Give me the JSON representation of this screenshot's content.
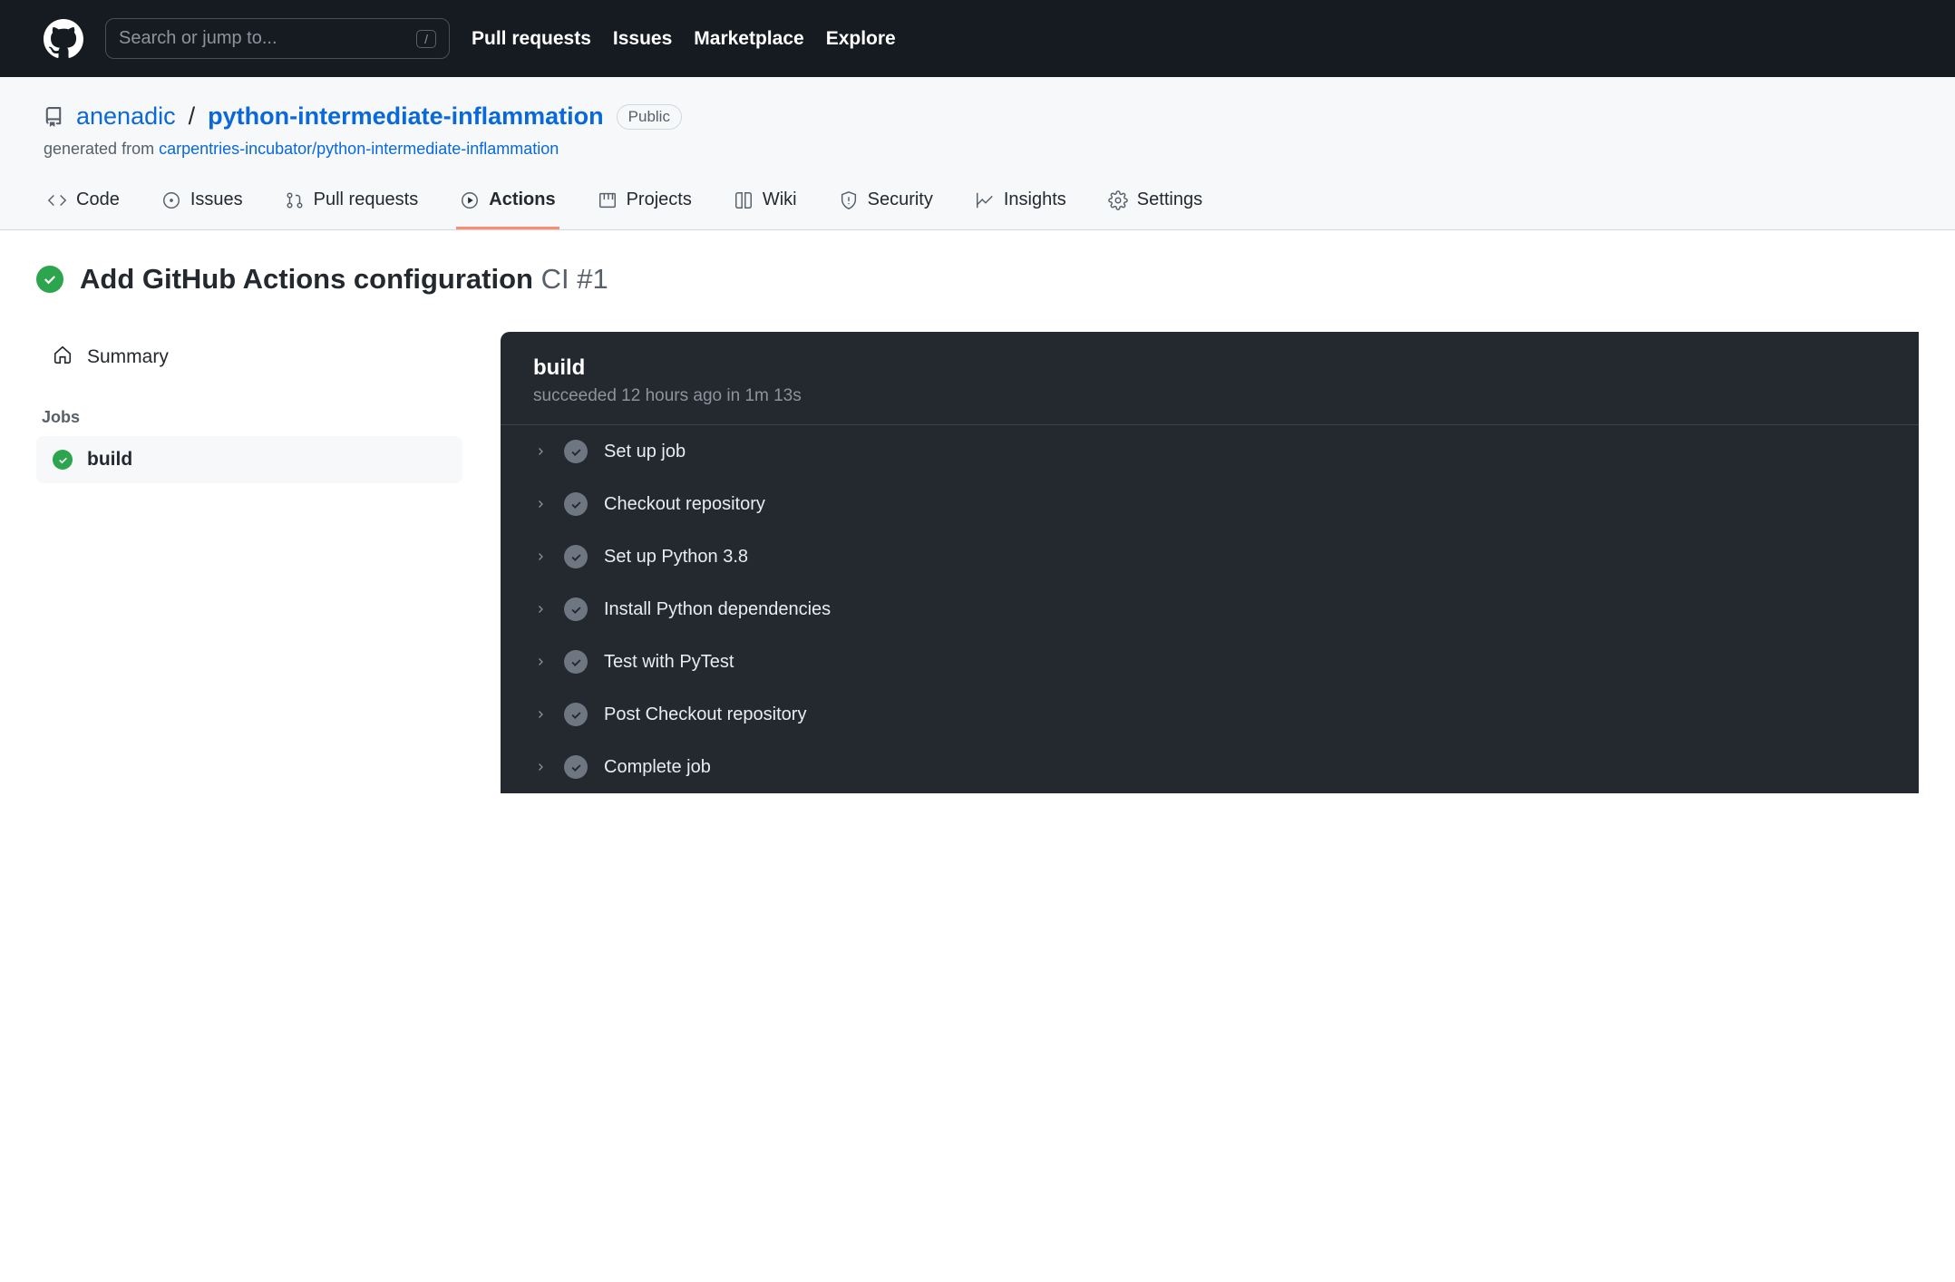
{
  "topnav": {
    "search_placeholder": "Search or jump to...",
    "slash_hint": "/",
    "links": [
      "Pull requests",
      "Issues",
      "Marketplace",
      "Explore"
    ]
  },
  "repo": {
    "owner": "anenadic",
    "name": "python-intermediate-inflammation",
    "visibility": "Public",
    "generated_prefix": "generated from ",
    "generated_link": "carpentries-incubator/python-intermediate-inflammation"
  },
  "tabs": {
    "items": [
      {
        "label": "Code"
      },
      {
        "label": "Issues"
      },
      {
        "label": "Pull requests"
      },
      {
        "label": "Actions",
        "selected": true
      },
      {
        "label": "Projects"
      },
      {
        "label": "Wiki"
      },
      {
        "label": "Security"
      },
      {
        "label": "Insights"
      },
      {
        "label": "Settings"
      }
    ]
  },
  "run": {
    "title_strong": "Add GitHub Actions configuration",
    "title_muted": "CI #1"
  },
  "sidebar": {
    "summary_label": "Summary",
    "jobs_label": "Jobs",
    "jobs": [
      {
        "label": "build",
        "selected": true
      }
    ]
  },
  "log": {
    "job_name": "build",
    "status_line": "succeeded 12 hours ago in 1m 13s",
    "steps": [
      "Set up job",
      "Checkout repository",
      "Set up Python 3.8",
      "Install Python dependencies",
      "Test with PyTest",
      "Post Checkout repository",
      "Complete job"
    ]
  }
}
